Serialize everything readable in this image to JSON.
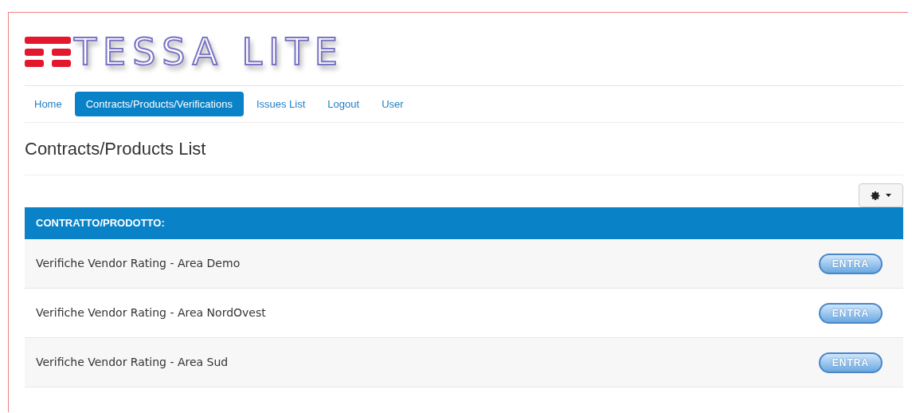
{
  "logo": {
    "text": "TESSA LITE"
  },
  "nav": [
    {
      "label": "Home",
      "selected": false
    },
    {
      "label": "Contracts/Products/Verifications",
      "selected": true
    },
    {
      "label": "Issues List",
      "selected": false
    },
    {
      "label": "Logout",
      "selected": false
    },
    {
      "label": "User",
      "selected": false
    }
  ],
  "page_title": "Contracts/Products List",
  "table": {
    "header": "CONTRATTO/PRODOTTO:",
    "rows": [
      {
        "name": "Verifiche Vendor Rating - Area Demo",
        "action": "ENTRA"
      },
      {
        "name": "Verifiche Vendor Rating - Area NordOvest",
        "action": "ENTRA"
      },
      {
        "name": "Verifiche Vendor Rating - Area Sud",
        "action": "ENTRA"
      }
    ]
  }
}
